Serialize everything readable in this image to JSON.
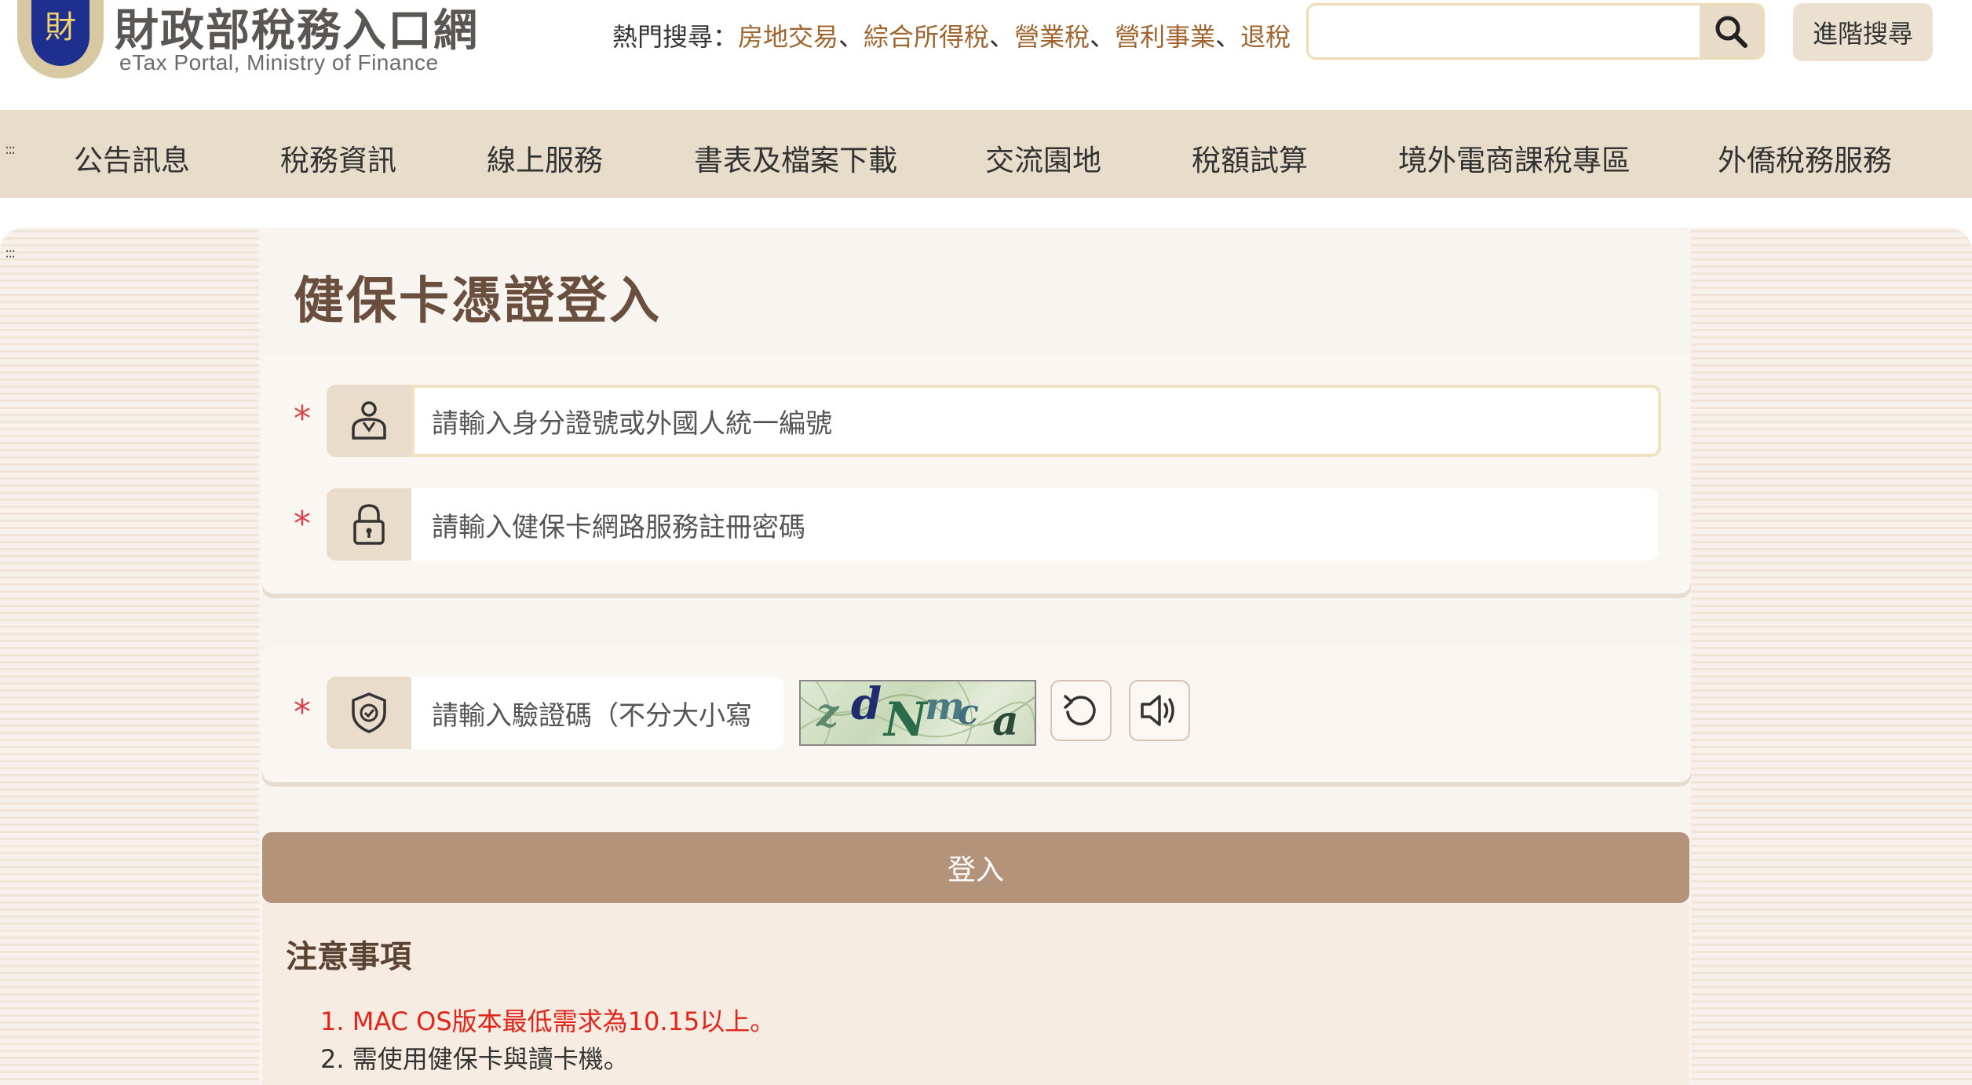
{
  "header": {
    "logo_title": "財政部稅務入口網",
    "logo_subtitle": "eTax Portal, Ministry of Finance",
    "emblem_text": "財",
    "hot_search_label": "熱門搜尋：",
    "hot_search_keywords": [
      "房地交易",
      "綜合所得稅",
      "營業稅",
      "營利事業",
      "退稅"
    ],
    "search_placeholder": "",
    "advanced_search": "進階搜尋"
  },
  "nav": {
    "items": [
      "公告訊息",
      "稅務資訊",
      "線上服務",
      "書表及檔案下載",
      "交流園地",
      "稅額試算",
      "境外電商課稅專區",
      "外僑稅務服務"
    ]
  },
  "login": {
    "title": "健保卡憑證登入",
    "required_mark": "*",
    "id_placeholder": "請輸入身分證號或外國人統一編號",
    "password_placeholder": "請輸入健保卡網路服務註冊密碼",
    "captcha_placeholder": "請輸入驗證碼（不分大小寫",
    "captcha_chars": [
      "z",
      "d",
      "N",
      "m",
      "c",
      "a"
    ],
    "login_button": "登入"
  },
  "notice": {
    "title": "注意事項",
    "items": [
      "1. MAC OS版本最低需求為10.15以上。",
      "2. 需使用健保卡與讀卡機。"
    ]
  },
  "colors": {
    "accent_brown": "#b39379",
    "keyword_link": "#a0652e",
    "required_red": "#d9444a",
    "notice_red": "#e1251b",
    "nav_bg": "#e8dccb"
  }
}
